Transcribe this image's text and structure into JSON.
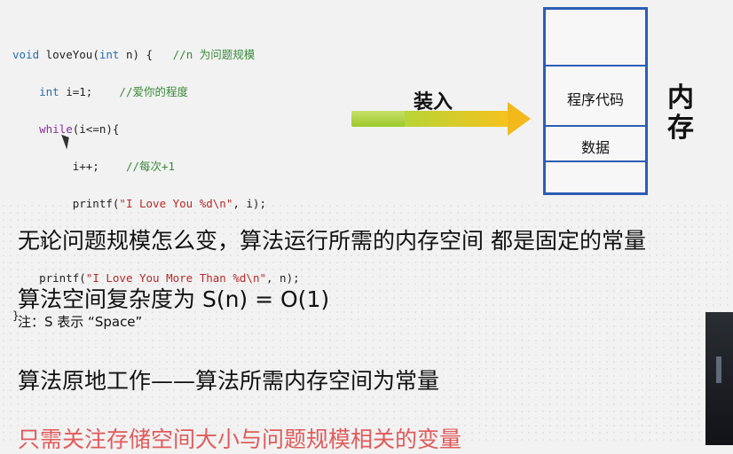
{
  "code": {
    "line1": {
      "kw": "void",
      "rest": " loveYou(",
      "kw2": "int",
      "rest2": " n) {   ",
      "comment": "//n 为问题规模"
    },
    "line2": {
      "kw": "int",
      "rest": " i=1;    ",
      "comment": "//爱你的程度"
    },
    "line3": {
      "kw": "while",
      "rest": "(i<=n){"
    },
    "line4": {
      "rest": "i++;    ",
      "comment": "//每次+1"
    },
    "line5": {
      "rest": "printf(",
      "str": "\"I Love You %d\\n\"",
      "rest2": ", i);"
    },
    "line6": {
      "rest": "}"
    },
    "line7": {
      "rest": "printf(",
      "str": "\"I Love You More Than %d\\n\"",
      "rest2": ", n);"
    },
    "line8": {
      "rest": "}"
    }
  },
  "diagram": {
    "arrow_label": "装入",
    "memory_title": "内存",
    "cells": [
      "程序代码",
      "数据"
    ]
  },
  "text": {
    "line1": "无论问题规模怎么变，算法运行所需的内存空间 都是固定的常量",
    "line2": "算法空间复杂度为 S(n) = O(1)",
    "note": "注：S 表示 “Space”",
    "line3": "算法原地工作——算法所需内存空间为常量",
    "line4": "只需关注存储空间大小与问题规模相关的变量"
  },
  "colors": {
    "memory_border": "#2c5db5",
    "highlight_text": "#e05b5b"
  }
}
